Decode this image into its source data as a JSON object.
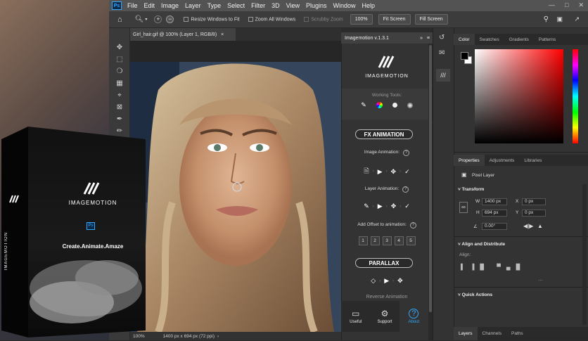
{
  "menubar": {
    "app_badge": "Ps",
    "items": [
      "File",
      "Edit",
      "Image",
      "Layer",
      "Type",
      "Select",
      "Filter",
      "3D",
      "View",
      "Plugins",
      "Window",
      "Help"
    ]
  },
  "options_bar": {
    "resize_windows": "Resize Windows to Fit",
    "zoom_all": "Zoom All Windows",
    "scrubby_zoom": "Scrubby Zoom",
    "zoom_value": "100%",
    "fit_screen": "Fit Screen",
    "fill_screen": "Fill Screen"
  },
  "document": {
    "tab_title": "Girl_hair.gif @ 100% (Layer 1, RGB/8)",
    "status_zoom": "100%",
    "status_info": "1400 px x 694 px (72 ppi)"
  },
  "imagemotion": {
    "header": "Imagemotion v.1.3.1",
    "logo_text": "IMAGEMOTION",
    "working_tools": "Working Tools:",
    "fx_animation": "FX ANIMATION",
    "image_animation": "Image Animation:",
    "layer_animation": "Layer Animation:",
    "add_offset": "Add Offset to animation:",
    "offsets": [
      "1",
      "2",
      "3",
      "4",
      "5"
    ],
    "parallax": "PARALLAX",
    "reverse_animation": "Reverse Animation",
    "footer": {
      "useful": "Useful",
      "support": "Support",
      "about": "About"
    }
  },
  "box": {
    "brand": "IMAGEMOTION",
    "side_text": "IMAGEMOTION",
    "ps_badge": "Ps",
    "tagline": "Create.Animate.Amaze"
  },
  "color_panel": {
    "tabs": [
      "Color",
      "Swatches",
      "Gradients",
      "Patterns"
    ]
  },
  "properties_panel": {
    "tabs": [
      "Properties",
      "Adjustments",
      "Libraries"
    ],
    "pixel_layer": "Pixel Layer",
    "transform": "Transform",
    "w_label": "W",
    "w_value": "1400 px",
    "h_label": "H",
    "h_value": "694 px",
    "x_label": "X",
    "x_value": "0 px",
    "y_label": "Y",
    "y_value": "0 px",
    "angle_value": "0.00°",
    "align_distribute": "Align and Distribute",
    "align_label": "Align:",
    "quick_actions": "Quick Actions"
  },
  "layers_panel": {
    "tabs": [
      "Layers",
      "Channels",
      "Paths"
    ]
  },
  "colors": {
    "accent_blue": "#31a8ff",
    "foreground": "#000000",
    "background": "#ffffff"
  }
}
